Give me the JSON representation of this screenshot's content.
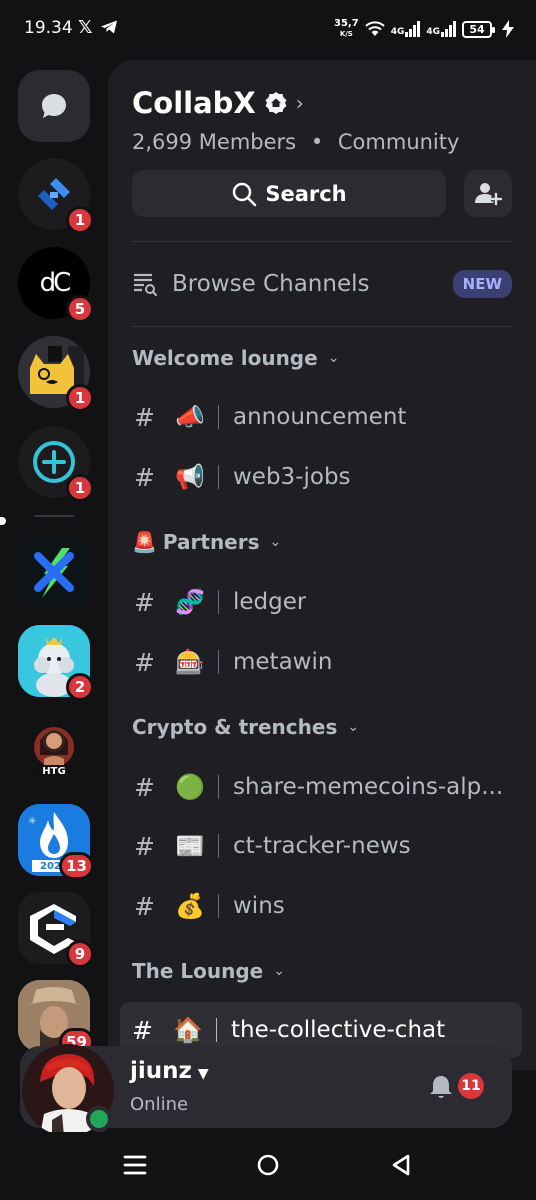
{
  "status_bar": {
    "time": "19.34",
    "x_glyph": "𝕏",
    "speed_value": "35,7",
    "speed_unit": "K/S",
    "net1": "4G",
    "net2": "4G",
    "battery": "54",
    "icons": [
      "x-icon",
      "telegram-icon",
      "wifi-icon",
      "signal-icon",
      "battery-icon",
      "charging-icon"
    ]
  },
  "rail": {
    "servers": [
      {
        "name": "direct-messages",
        "badge": ""
      },
      {
        "name": "server-blue-arrows",
        "badge": "1"
      },
      {
        "name": "server-dc",
        "badge": "5",
        "logo_text": "dC"
      },
      {
        "name": "server-cat",
        "badge": "1"
      },
      {
        "name": "server-plus",
        "badge": "1"
      },
      {
        "name": "server-x-lightning",
        "badge": "",
        "logo_text": "X"
      },
      {
        "name": "server-poodle",
        "badge": "2"
      },
      {
        "name": "server-htg",
        "badge": "",
        "logo_text": "HTG"
      },
      {
        "name": "server-flame",
        "badge": "13",
        "logo_text": "202"
      },
      {
        "name": "server-e-logo",
        "badge": "9"
      },
      {
        "name": "server-cowboy",
        "badge": "59"
      }
    ]
  },
  "server": {
    "name": "CollabX",
    "members": "2,699 Members",
    "dot": "•",
    "type": "Community",
    "search_label": "Search",
    "browse_label": "Browse Channels",
    "new_badge": "NEW"
  },
  "categories": [
    {
      "label": "Welcome lounge",
      "emoji": "",
      "channels": [
        {
          "emoji": "📣",
          "name": "announcement"
        },
        {
          "emoji": "📢",
          "name": "web3-jobs"
        }
      ]
    },
    {
      "label": "Partners",
      "emoji": "🚨",
      "channels": [
        {
          "emoji": "🧬",
          "name": "ledger"
        },
        {
          "emoji": "🎰",
          "name": "metawin"
        }
      ]
    },
    {
      "label": "Crypto & trenches",
      "emoji": "",
      "channels": [
        {
          "emoji": "🟢",
          "name": "share-memecoins-alp..."
        },
        {
          "emoji": "📰",
          "name": "ct-tracker-news"
        },
        {
          "emoji": "💰",
          "name": "wins"
        }
      ]
    },
    {
      "label": "The Lounge",
      "emoji": "",
      "channels": [
        {
          "emoji": "🏠",
          "name": "the-collective-chat",
          "active": true
        }
      ]
    }
  ],
  "user": {
    "name": "jiunz",
    "status": "Online",
    "notif_count": "11"
  },
  "colors": {
    "background": "#121214",
    "panel": "#1f1f23",
    "badge_red": "#da373c",
    "online_green": "#23a55a",
    "new_badge": "#3b3f72"
  }
}
